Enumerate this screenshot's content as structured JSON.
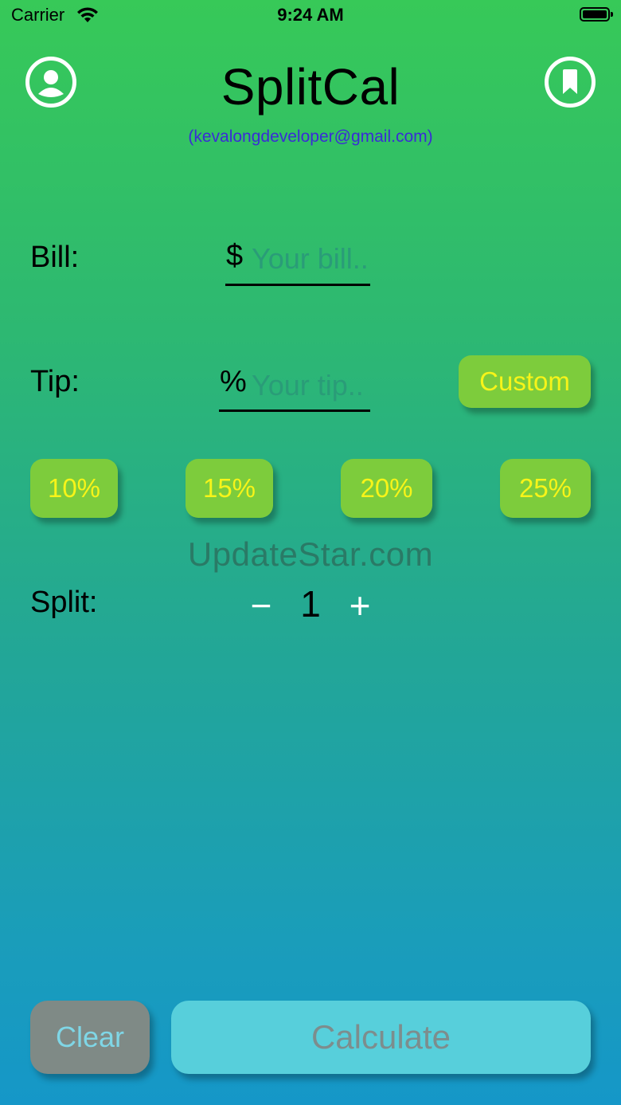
{
  "status_bar": {
    "carrier": "Carrier",
    "time": "9:24 AM"
  },
  "header": {
    "title": "SplitCal",
    "email": "(kevalongdeveloper@gmail.com)",
    "profile_icon": "person-circle-icon",
    "bookmark_icon": "bookmark-icon"
  },
  "bill": {
    "label": "Bill:",
    "prefix": "$",
    "placeholder": "Your bill..",
    "value": ""
  },
  "tip": {
    "label": "Tip:",
    "prefix": "%",
    "placeholder": "Your tip..",
    "value": "",
    "custom_label": "Custom"
  },
  "tip_presets": [
    "10%",
    "15%",
    "20%",
    "25%"
  ],
  "watermark": "UpdateStar.com",
  "split": {
    "label": "Split:",
    "minus": "−",
    "value": "1",
    "plus": "+"
  },
  "actions": {
    "clear_label": "Clear",
    "calculate_label": "Calculate"
  },
  "colors": {
    "pill_bg": "#7dcc3c",
    "pill_text": "#f7f419",
    "email_text": "#3a2cd6",
    "calculate_bg": "#57cfdb",
    "clear_bg": "#7f8a86"
  }
}
